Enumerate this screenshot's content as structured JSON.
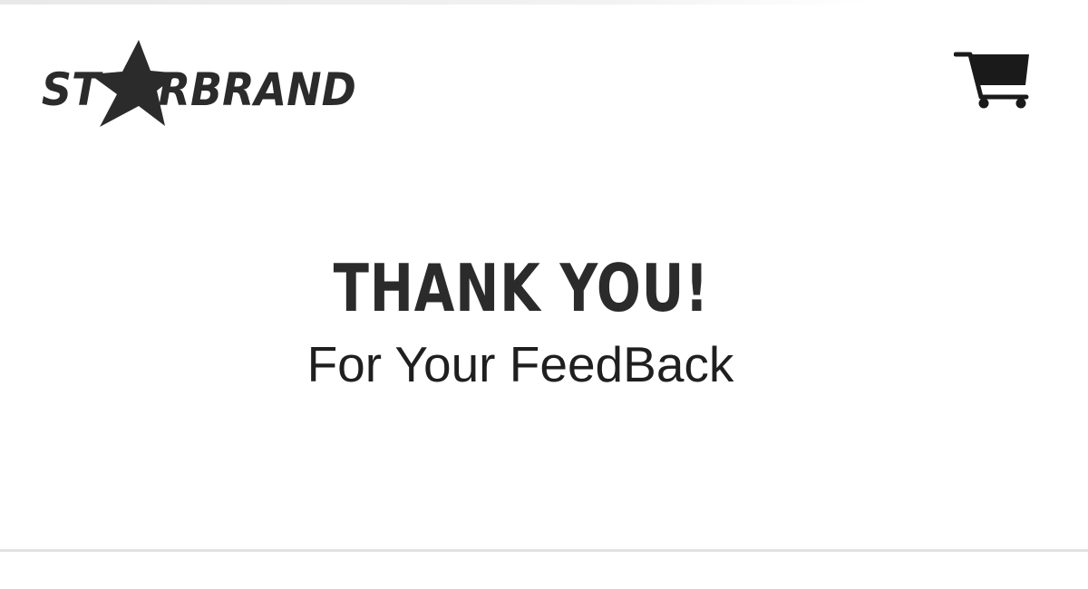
{
  "header": {
    "logo": {
      "text": "STARBRAND",
      "prefix": "ST",
      "suffix": "RBRAND",
      "icon": "star-icon",
      "color": "#2b2b2b"
    },
    "cart": {
      "icon": "shopping-cart-icon",
      "color": "#1a1a1a"
    }
  },
  "main": {
    "title": "THANK YOU!",
    "subtitle": "For Your FeedBack"
  },
  "colors": {
    "background": "#ffffff",
    "text": "#2b2b2b",
    "divider": "#e2e2e2"
  }
}
